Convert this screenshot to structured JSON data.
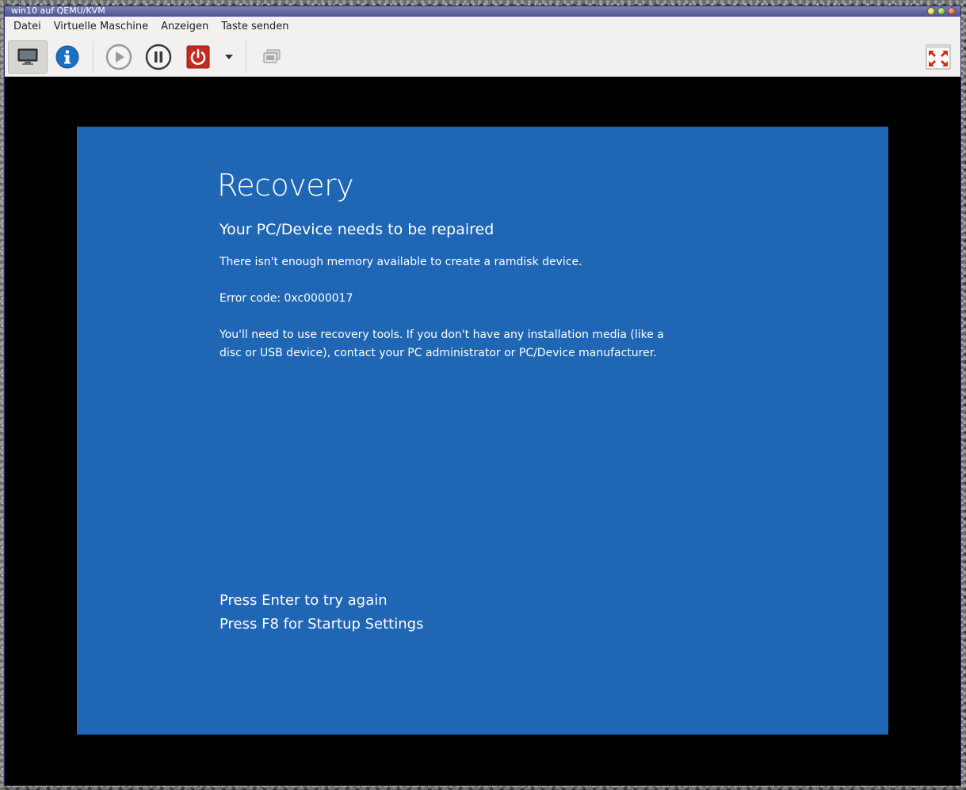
{
  "window": {
    "title": "win10 auf QEMU/KVM"
  },
  "menu": {
    "items": [
      "Datei",
      "Virtuelle Maschine",
      "Anzeigen",
      "Taste senden"
    ]
  },
  "toolbar": {
    "icons": [
      "monitor-icon",
      "info-icon",
      "play-icon",
      "pause-icon",
      "power-icon",
      "dropdown-arrow-icon",
      "screenshot-icon",
      "fullscreen-icon"
    ]
  },
  "recovery": {
    "title": "Recovery",
    "subtitle": "Your PC/Device needs to be repaired",
    "message": "There isn't enough memory available to create a ramdisk device.",
    "error_code": "Error code: 0xc0000017",
    "advice": "You'll need to use recovery tools. If you don't have any installation media (like a disc or USB device), contact your PC administrator or PC/Device manufacturer.",
    "action_enter": "Press Enter to try again",
    "action_f8": "Press F8 for Startup Settings"
  },
  "colors": {
    "recovery_background": "#1f66b5",
    "power_button": "#c42a1e",
    "info_button": "#1d6fc4"
  }
}
